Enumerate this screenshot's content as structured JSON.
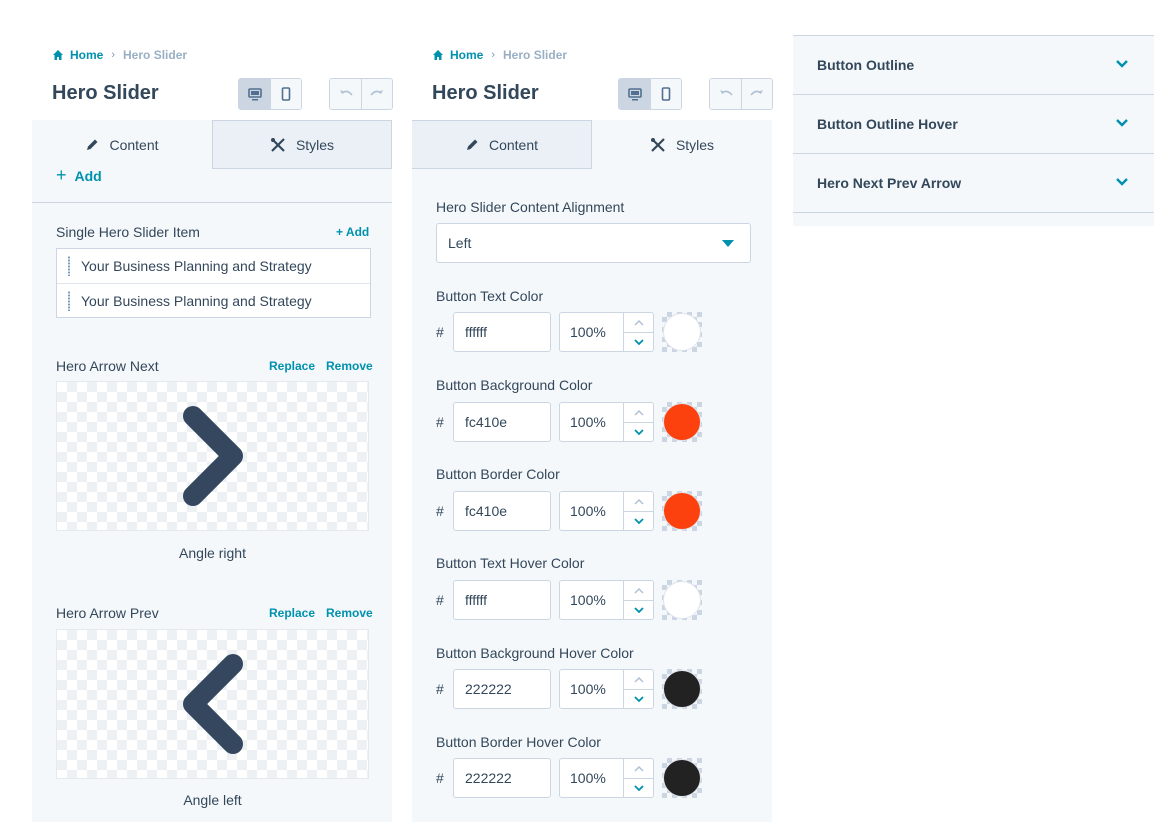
{
  "left_panel": {
    "breadcrumb": {
      "home": "Home",
      "current": "Hero Slider"
    },
    "title": "Hero Slider",
    "tabs": {
      "content": "Content",
      "styles": "Styles"
    },
    "add_label": "Add",
    "slider_items": {
      "label": "Single Hero Slider Item",
      "add_link": "+ Add",
      "items": [
        "Your Business Planning and Strategy",
        "Your Business Planning and Strategy"
      ]
    },
    "arrow_next": {
      "label": "Hero Arrow Next",
      "replace": "Replace",
      "remove": "Remove",
      "caption": "Angle right"
    },
    "arrow_prev": {
      "label": "Hero Arrow Prev",
      "replace": "Replace",
      "remove": "Remove",
      "caption": "Angle left"
    },
    "arrow_color": "#34475f"
  },
  "middle_panel": {
    "breadcrumb": {
      "home": "Home",
      "current": "Hero Slider"
    },
    "title": "Hero Slider",
    "tabs": {
      "content": "Content",
      "styles": "Styles"
    },
    "alignment": {
      "label": "Hero Slider Content Alignment",
      "value": "Left"
    },
    "color_fields": [
      {
        "label": "Button Text Color",
        "hash": "#",
        "hex": "ffffff",
        "opacity": "100%",
        "swatch": "#ffffff"
      },
      {
        "label": "Button Background Color",
        "hash": "#",
        "hex": "fc410e",
        "opacity": "100%",
        "swatch": "#fc410e"
      },
      {
        "label": "Button Border Color",
        "hash": "#",
        "hex": "fc410e",
        "opacity": "100%",
        "swatch": "#fc410e"
      },
      {
        "label": "Button Text Hover Color",
        "hash": "#",
        "hex": "ffffff",
        "opacity": "100%",
        "swatch": "#ffffff"
      },
      {
        "label": "Button Background Hover Color",
        "hash": "#",
        "hex": "222222",
        "opacity": "100%",
        "swatch": "#222222"
      },
      {
        "label": "Button Border Hover Color",
        "hash": "#",
        "hex": "222222",
        "opacity": "100%",
        "swatch": "#222222"
      }
    ]
  },
  "right_panel": {
    "accordions": [
      "Button Outline",
      "Button Outline Hover",
      "Hero Next Prev Arrow"
    ]
  },
  "colors": {
    "accent": "#0091ae",
    "text": "#33475b",
    "panel_bg": "#f5f8fa",
    "border": "#cbd6e2"
  }
}
